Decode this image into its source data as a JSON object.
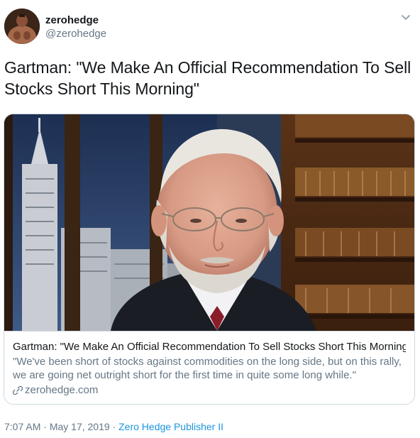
{
  "user": {
    "display_name": "zerohedge",
    "handle": "@zerohedge",
    "avatar_icon": "avatar-image"
  },
  "menu": {
    "icon": "chevron-down-icon"
  },
  "tweet": {
    "text": "Gartman: \"We Make An Official Recommendation To Sell Stocks Short This Morning\""
  },
  "card": {
    "title": "Gartman: \"We Make An Official Recommendation To Sell Stocks Short This Morning\"",
    "description": "\"We've been short of stocks against commodities on the long side, but on this rally, we are going net outright short for the first time in quite some long while.\"",
    "domain": "zerohedge.com",
    "domain_icon": "link-icon"
  },
  "meta": {
    "time": "7:07 AM",
    "separator": " · ",
    "date": "May 17, 2019",
    "separator2": " · ",
    "source": "Zero Hedge Publisher II"
  },
  "colors": {
    "link_blue": "#1b95e0",
    "secondary_text": "#657786",
    "primary_text": "#14171a",
    "border": "#cfd9de"
  }
}
